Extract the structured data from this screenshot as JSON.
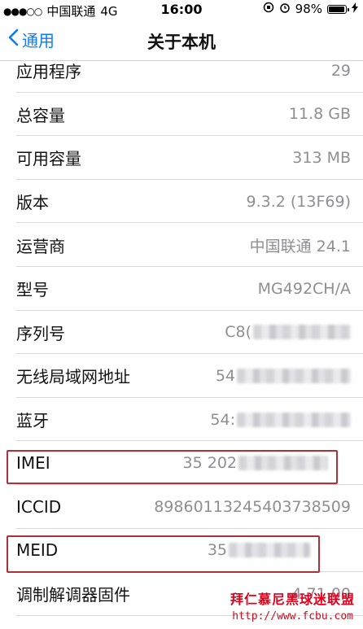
{
  "status_bar": {
    "signal_dots": "●●●○○",
    "carrier": "中国联通",
    "network": "4G",
    "time": "16:00",
    "battery": "98%"
  },
  "nav": {
    "back_label": "通用",
    "title": "关于本机"
  },
  "rows": [
    {
      "label": "应用程序",
      "value": "29"
    },
    {
      "label": "总容量",
      "value": "11.8 GB"
    },
    {
      "label": "可用容量",
      "value": "313 MB"
    },
    {
      "label": "版本",
      "value": "9.3.2 (13F69)"
    },
    {
      "label": "运营商",
      "value": "中国联通 24.1"
    },
    {
      "label": "型号",
      "value": "MG492CH/A"
    },
    {
      "label": "序列号",
      "value": "C8("
    },
    {
      "label": "无线局域网地址",
      "value": "54"
    },
    {
      "label": "蓝牙",
      "value": "54:"
    },
    {
      "label": "IMEI",
      "value": "35 202"
    },
    {
      "label": "ICCID",
      "value": "89860113245403738509"
    },
    {
      "label": "MEID",
      "value": "35"
    },
    {
      "label": "调制解调器固件",
      "value": "4.71.00"
    }
  ],
  "watermark": {
    "text": "拜仁慕尼黑球迷联盟",
    "url": "http://www.fcbu.com"
  },
  "colors": {
    "accent": "#0a7cf5",
    "highlight_box": "#b0303a",
    "watermark": "#e0001c"
  }
}
